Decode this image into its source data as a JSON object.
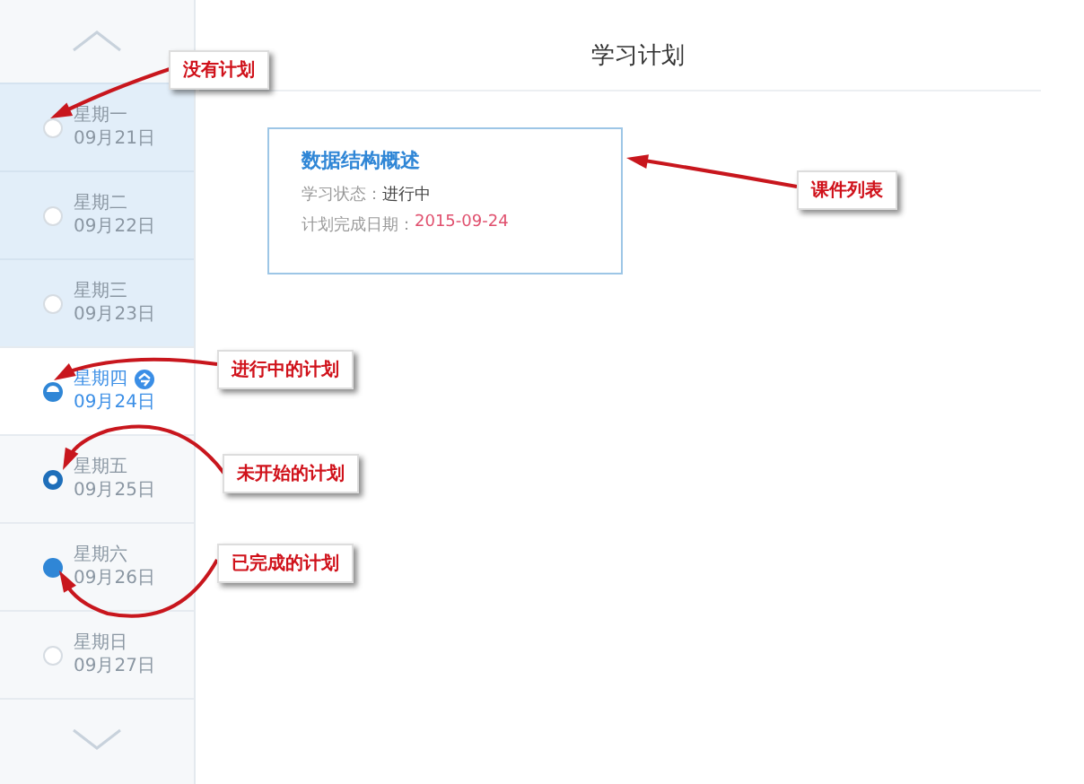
{
  "sidebar": {
    "days": [
      {
        "weekday": "星期一",
        "date": "09月21日",
        "kind": "none",
        "past": true,
        "selected": false,
        "today": false
      },
      {
        "weekday": "星期二",
        "date": "09月22日",
        "kind": "none",
        "past": true,
        "selected": false,
        "today": false
      },
      {
        "weekday": "星期三",
        "date": "09月23日",
        "kind": "none",
        "past": true,
        "selected": false,
        "today": false
      },
      {
        "weekday": "星期四",
        "date": "09月24日",
        "kind": "in_progress",
        "past": false,
        "selected": true,
        "today": true
      },
      {
        "weekday": "星期五",
        "date": "09月25日",
        "kind": "not_started",
        "past": false,
        "selected": false,
        "today": false
      },
      {
        "weekday": "星期六",
        "date": "09月26日",
        "kind": "completed",
        "past": false,
        "selected": false,
        "today": false
      },
      {
        "weekday": "星期日",
        "date": "09月27日",
        "kind": "none",
        "past": false,
        "selected": false,
        "today": false
      }
    ]
  },
  "main": {
    "title": "学习计划",
    "courses": [
      {
        "title": "数据结构概述",
        "status_label": "学习状态：",
        "status": "进行中",
        "due_label": "计划完成日期：",
        "due": "2015-09-24"
      }
    ]
  },
  "annotations": [
    {
      "text": "没有计划"
    },
    {
      "text": "课件列表"
    },
    {
      "text": "进行中的计划"
    },
    {
      "text": "未开始的计划"
    },
    {
      "text": "已完成的计划"
    }
  ]
}
